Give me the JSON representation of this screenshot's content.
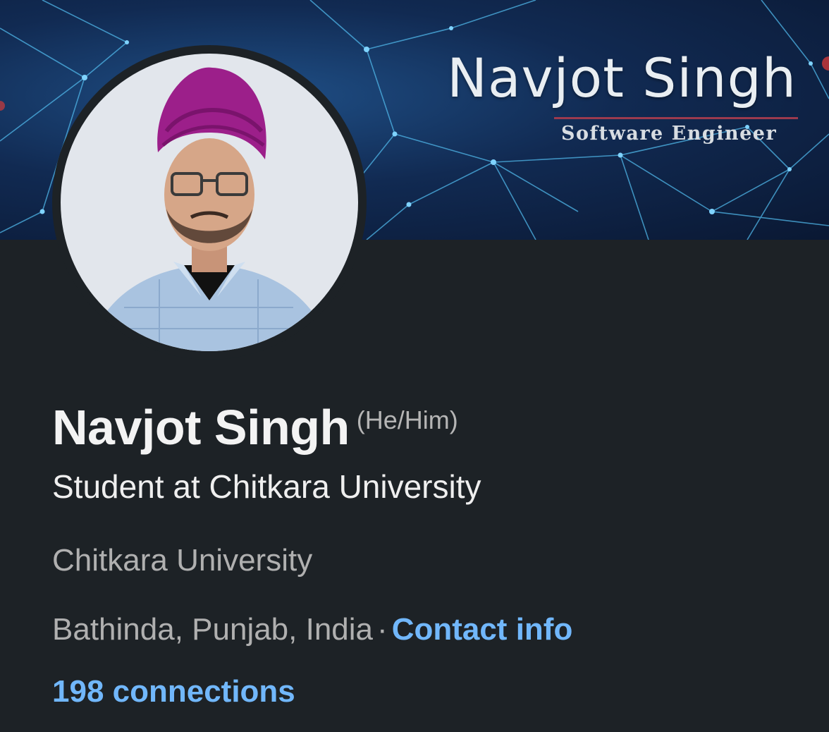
{
  "banner": {
    "title": "Navjot Singh",
    "subtitle": "Software Engineer",
    "rule_color": "#9b3a4e"
  },
  "profile": {
    "name": "Navjot Singh",
    "pronouns": "(He/Him)",
    "headline": "Student at Chitkara University",
    "education": "Chitkara University",
    "location": "Bathinda, Punjab, India",
    "separator": "·",
    "contact_info_label": "Contact info",
    "connections_label": "198 connections"
  },
  "colors": {
    "background": "#1d2226",
    "link": "#71b7fb",
    "turban": "#9c1f8a"
  }
}
